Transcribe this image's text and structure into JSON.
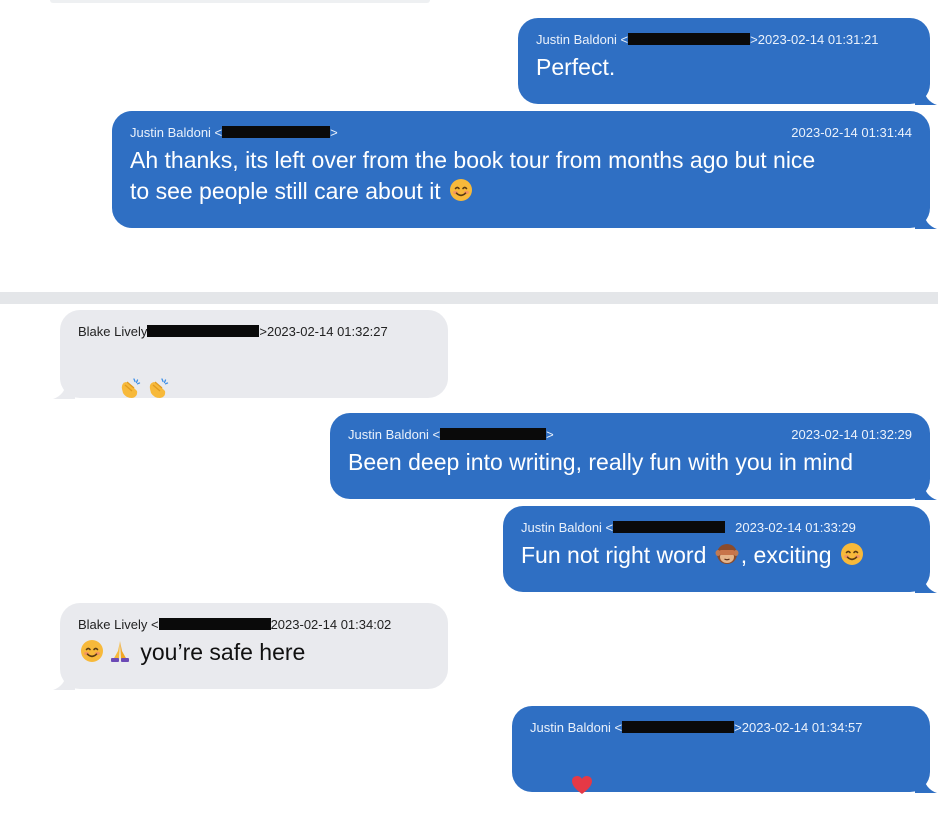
{
  "colors": {
    "outgoing_bubble": "#2f6fc3",
    "incoming_bubble": "#e9eaee",
    "divider": "#e4e6e9"
  },
  "messages": [
    {
      "sender": "Justin Baldoni <",
      "sender_end": ">",
      "timestamp": "2023-02-14 01:31:21",
      "text": "Perfect.",
      "direction": "outgoing"
    },
    {
      "sender": "Justin Baldoni <",
      "sender_end": ">",
      "timestamp": "2023-02-14 01:31:44",
      "text": "Ah thanks, its left over from the book tour from months ago but nice\nto see people still care about it",
      "emoji_after": "smiling-face-icon",
      "direction": "outgoing"
    },
    {
      "sender": "Blake Lively ",
      "sender_end": ">",
      "timestamp": "2023-02-14 01:32:27",
      "text": "",
      "emojis": [
        "clapping-hands-icon",
        "clapping-hands-icon"
      ],
      "direction": "incoming"
    },
    {
      "sender": "Justin Baldoni <",
      "sender_end": ">",
      "timestamp": "2023-02-14 01:32:29",
      "text": "Been deep into writing, really fun with you in mind",
      "direction": "outgoing"
    },
    {
      "sender": "Justin Baldoni <",
      "sender_end": ">",
      "timestamp": "2023-02-14 01:33:29",
      "text_before": "Fun not right word",
      "text_middle": ", exciting",
      "emojis": [
        "see-no-evil-monkey-icon",
        "smiling-face-icon"
      ],
      "direction": "outgoing"
    },
    {
      "sender": "Blake Lively <",
      "sender_end": "",
      "timestamp": "2023-02-14 01:34:02",
      "text": "you’re safe here",
      "emojis": [
        "smiling-face-icon",
        "folded-hands-icon"
      ],
      "direction": "incoming"
    },
    {
      "sender": "Justin Baldoni <",
      "sender_end": ">",
      "timestamp": "2023-02-14 01:34:57",
      "text": "",
      "emojis": [
        "red-heart-icon"
      ],
      "direction": "outgoing"
    }
  ]
}
